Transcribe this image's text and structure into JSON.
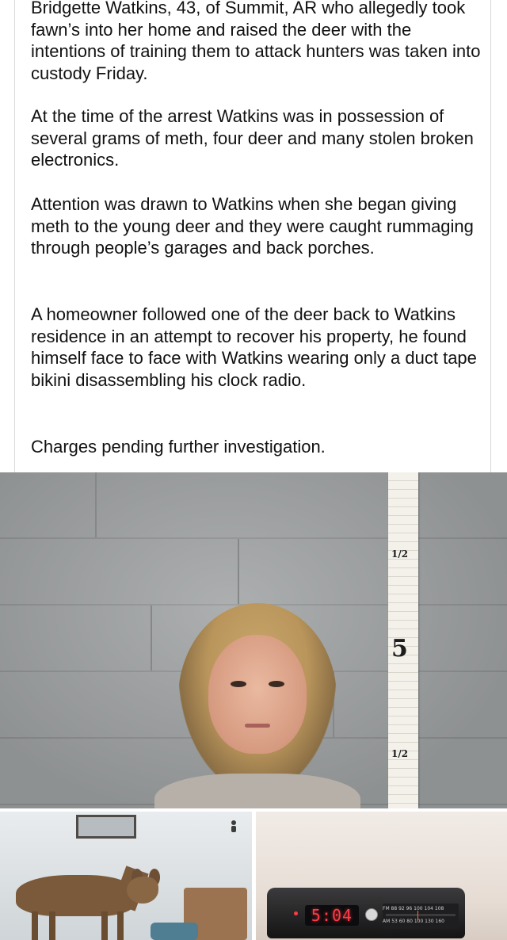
{
  "post": {
    "paragraphs": [
      "Bridgette Watkins, 43, of Summit, AR who allegedly took fawn’s into her home and raised the deer with the intentions of training them to attack hunters was taken into custody Friday.",
      "At the time of the arrest Watkins was in possession of  several grams of meth, four deer and many stolen broken electronics.",
      "Attention was drawn to Watkins when she began giving meth to the young deer and they were caught rummaging through people’s garages and back porches.",
      "A homeowner followed one of the deer back to Watkins residence in an attempt to recover his property, he found himself face to face with Watkins wearing only a duct tape bikini disassembling his clock radio.",
      "Charges pending further investigation."
    ]
  },
  "mugshot": {
    "ruler_main_mark": "5",
    "ruler_half_mark_upper": "1/2",
    "ruler_half_mark_lower": "1/2"
  },
  "radio_photo": {
    "clock_display": "5:04",
    "dial_fm": "FM 88  92  96  100 104 108",
    "dial_am": "AM 53  60  80  100 130 160"
  },
  "colors": {
    "clock_led": "#ff3b46",
    "card_border": "#d8d8d8",
    "text": "#111111"
  },
  "icons": {
    "deer_photo_corner": "small-figure-icon"
  }
}
